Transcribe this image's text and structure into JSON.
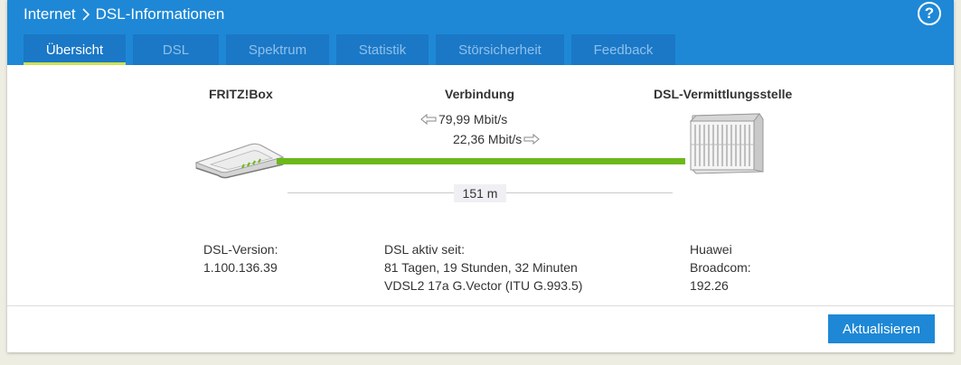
{
  "header": {
    "breadcrumb": [
      "Internet",
      "DSL-Informationen"
    ],
    "help_label": "?"
  },
  "tabs": [
    {
      "label": "Übersicht",
      "active": true
    },
    {
      "label": "DSL",
      "active": false
    },
    {
      "label": "Spektrum",
      "active": false
    },
    {
      "label": "Statistik",
      "active": false
    },
    {
      "label": "Störsicherheit",
      "active": false
    },
    {
      "label": "Feedback",
      "active": false
    }
  ],
  "overview": {
    "left_title": "FRITZ!Box",
    "center_title": "Verbindung",
    "right_title": "DSL-Vermittlungsstelle",
    "downstream": "79,99 Mbit/s",
    "upstream": "22,36 Mbit/s",
    "distance": "151 m"
  },
  "details": {
    "left": [
      "DSL-Version:",
      "1.100.136.39"
    ],
    "center": [
      "DSL aktiv seit:",
      "81 Tagen, 19 Stunden, 32 Minuten",
      "VDSL2 17a G.Vector (ITU G.993.5)"
    ],
    "right": [
      "Huawei",
      "Broadcom:",
      "192.26"
    ]
  },
  "actions": {
    "refresh_label": "Aktualisieren"
  },
  "colors": {
    "primary": "#1e88d6",
    "tab": "#1a78c7",
    "tab_underline": "#cbe255",
    "line": "#6cb81c",
    "background": "#eeede2"
  }
}
